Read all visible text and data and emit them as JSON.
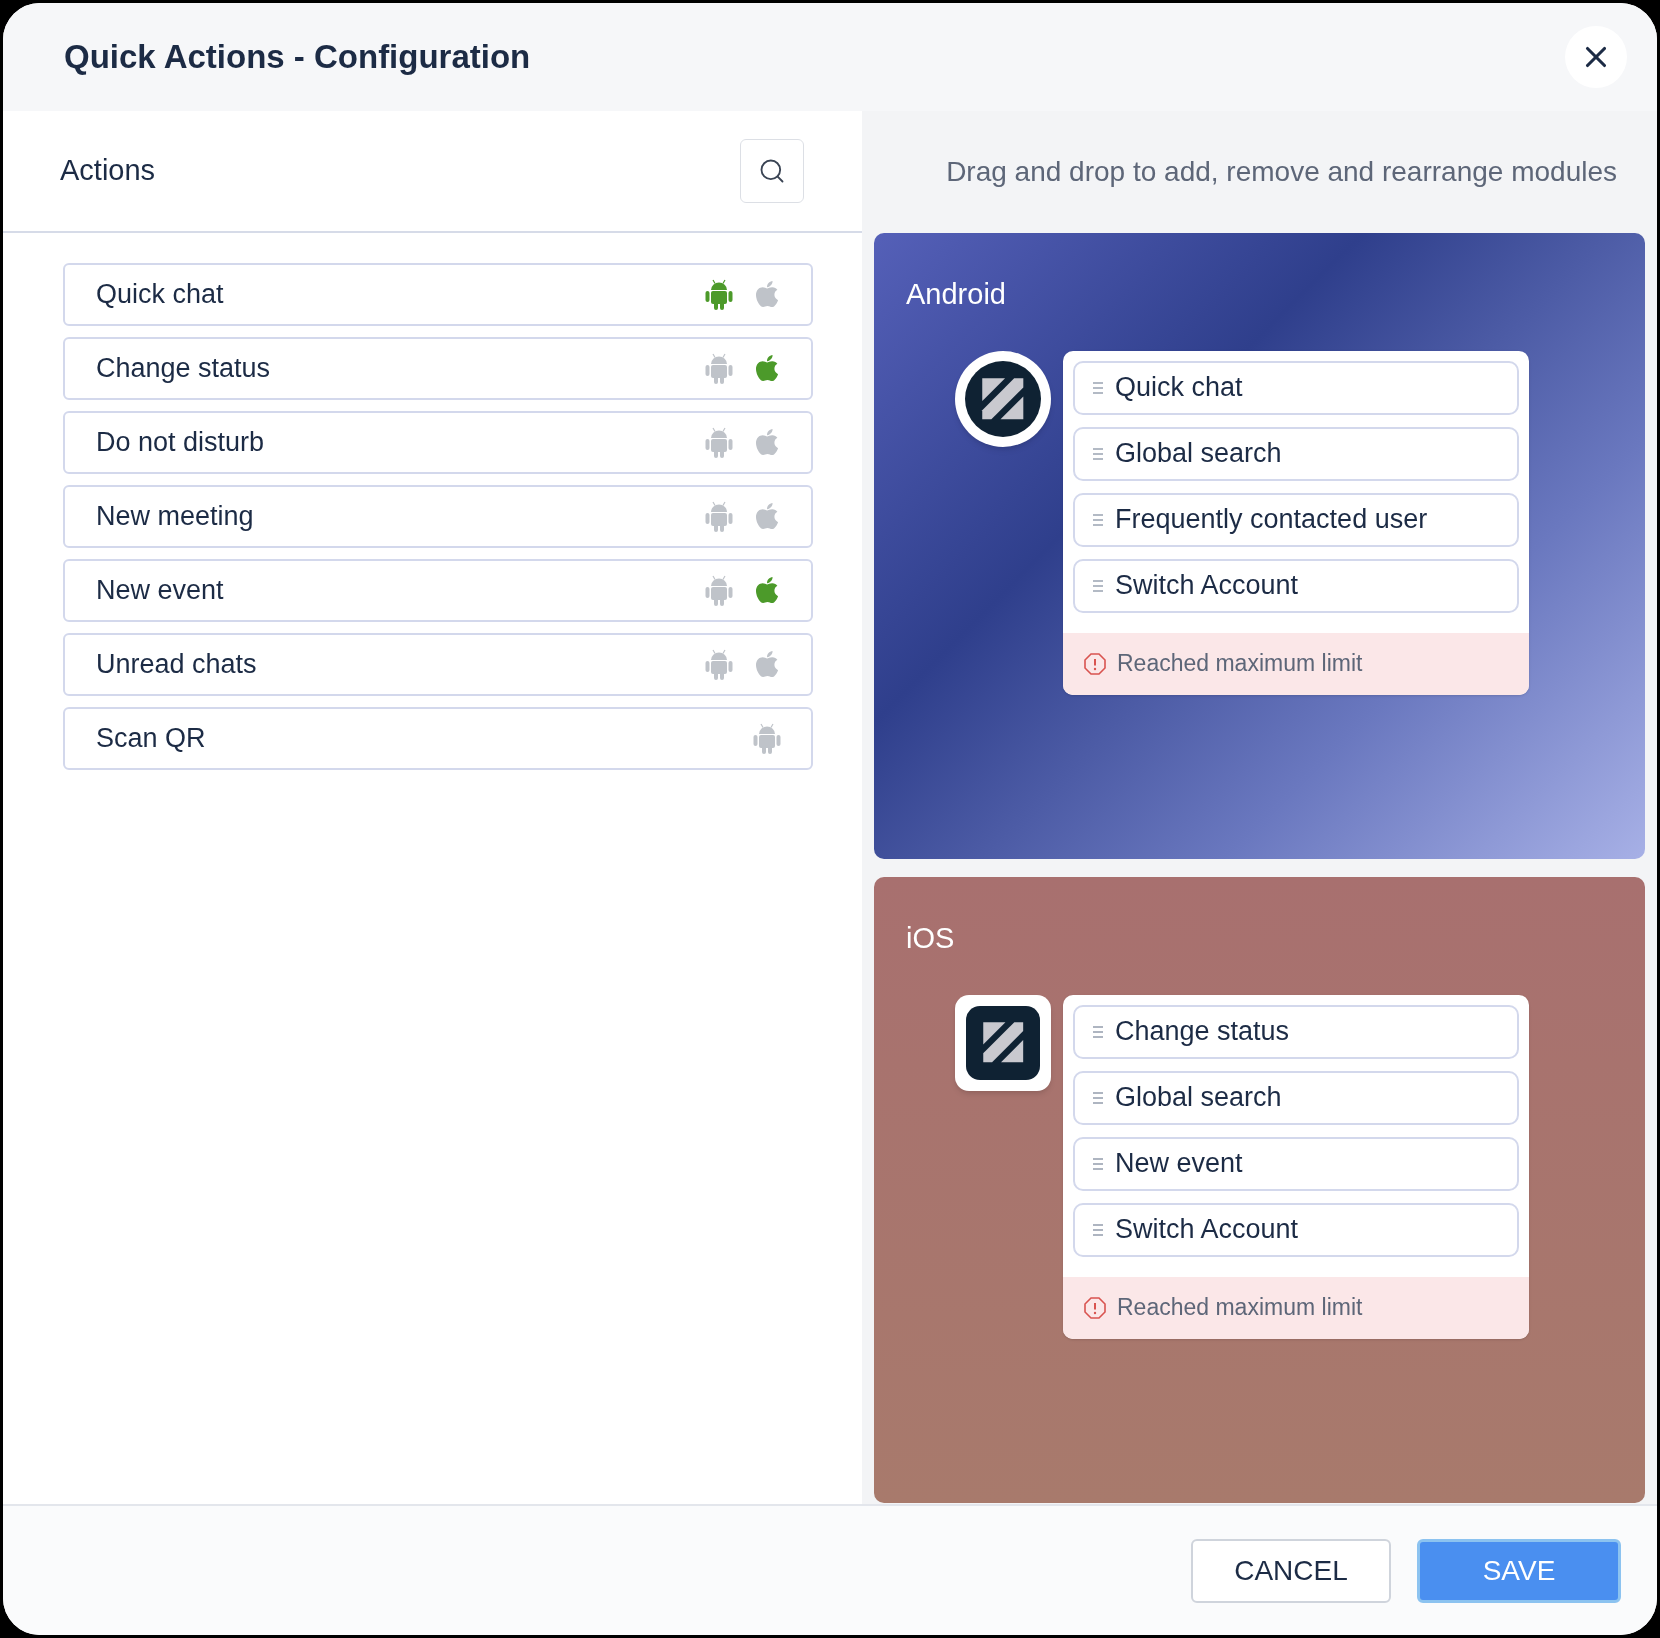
{
  "dialog": {
    "title": "Quick Actions - Configuration"
  },
  "actions_panel": {
    "title": "Actions",
    "items": [
      {
        "label": "Quick chat",
        "platforms": [
          {
            "kind": "android",
            "on": true
          },
          {
            "kind": "ios",
            "on": false
          }
        ]
      },
      {
        "label": "Change status",
        "platforms": [
          {
            "kind": "android",
            "on": false
          },
          {
            "kind": "ios",
            "on": true
          }
        ]
      },
      {
        "label": "Do not disturb",
        "platforms": [
          {
            "kind": "android",
            "on": false
          },
          {
            "kind": "ios",
            "on": false
          }
        ]
      },
      {
        "label": "New meeting",
        "platforms": [
          {
            "kind": "android",
            "on": false
          },
          {
            "kind": "ios",
            "on": false
          }
        ]
      },
      {
        "label": "New event",
        "platforms": [
          {
            "kind": "android",
            "on": false
          },
          {
            "kind": "ios",
            "on": true
          }
        ]
      },
      {
        "label": "Unread chats",
        "platforms": [
          {
            "kind": "android",
            "on": false
          },
          {
            "kind": "ios",
            "on": false
          }
        ]
      },
      {
        "label": "Scan QR",
        "platforms": [
          {
            "kind": "android",
            "on": false
          }
        ]
      }
    ]
  },
  "preview_panel": {
    "hint": "Drag and drop to add, remove and rearrange modules",
    "cards": [
      {
        "kind": "android",
        "title": "Android",
        "modules": [
          "Quick chat",
          "Global search",
          "Frequently contacted user",
          "Switch Account"
        ],
        "warning": "Reached maximum limit"
      },
      {
        "kind": "ios",
        "title": "iOS",
        "modules": [
          "Change status",
          "Global search",
          "New event",
          "Switch Account"
        ],
        "warning": "Reached maximum limit"
      }
    ]
  },
  "footer": {
    "buttons": [
      {
        "kind": "secondary",
        "label": "CANCEL"
      },
      {
        "kind": "primary",
        "label": "SAVE"
      }
    ]
  }
}
